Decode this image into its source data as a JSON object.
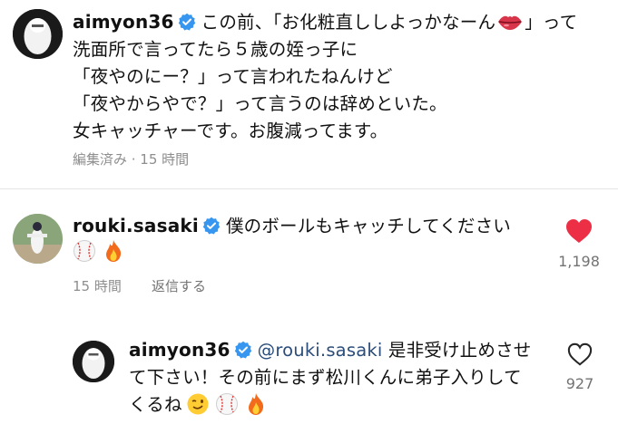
{
  "post": {
    "username": "aimyon36",
    "caption_lines": [
      "この前、「お化粧直ししよっかなーん",
      "洗面所で言ってたら５歳の姪っ子に",
      "「夜やのにー？」って言われたねんけど",
      "「夜やからやで？」って言うのは辞めといた。",
      "女キャッチャーです。お腹減ってます。"
    ],
    "caption_after_emoji": "」って",
    "meta": "編集済み · 15 時間"
  },
  "comment": {
    "username": "rouki.sasaki",
    "text": "僕のボールもキャッチしてください",
    "time": "15 時間",
    "reply_label": "返信する",
    "like_count": "1,198"
  },
  "reply": {
    "username": "aimyon36",
    "mention": "@rouki.sasaki",
    "text_line1_rest": " 是非受け止めさせ",
    "text_line2": "て下さい！その前にまず松川くんに弟子入りして",
    "text_line3": "くるね",
    "like_count": "927"
  },
  "colors": {
    "verified": "#3797f0",
    "heart_liked": "#ed2f46",
    "meta_text": "#8e8e8e",
    "mention": "#2a4d7a"
  },
  "icons": {
    "verified": "verified-badge-icon",
    "lips": "lips-emoji",
    "baseball": "baseball-emoji",
    "fire": "fire-emoji",
    "wink": "winking-face-emoji",
    "heart_filled": "heart-filled-icon",
    "heart_outline": "heart-outline-icon"
  }
}
